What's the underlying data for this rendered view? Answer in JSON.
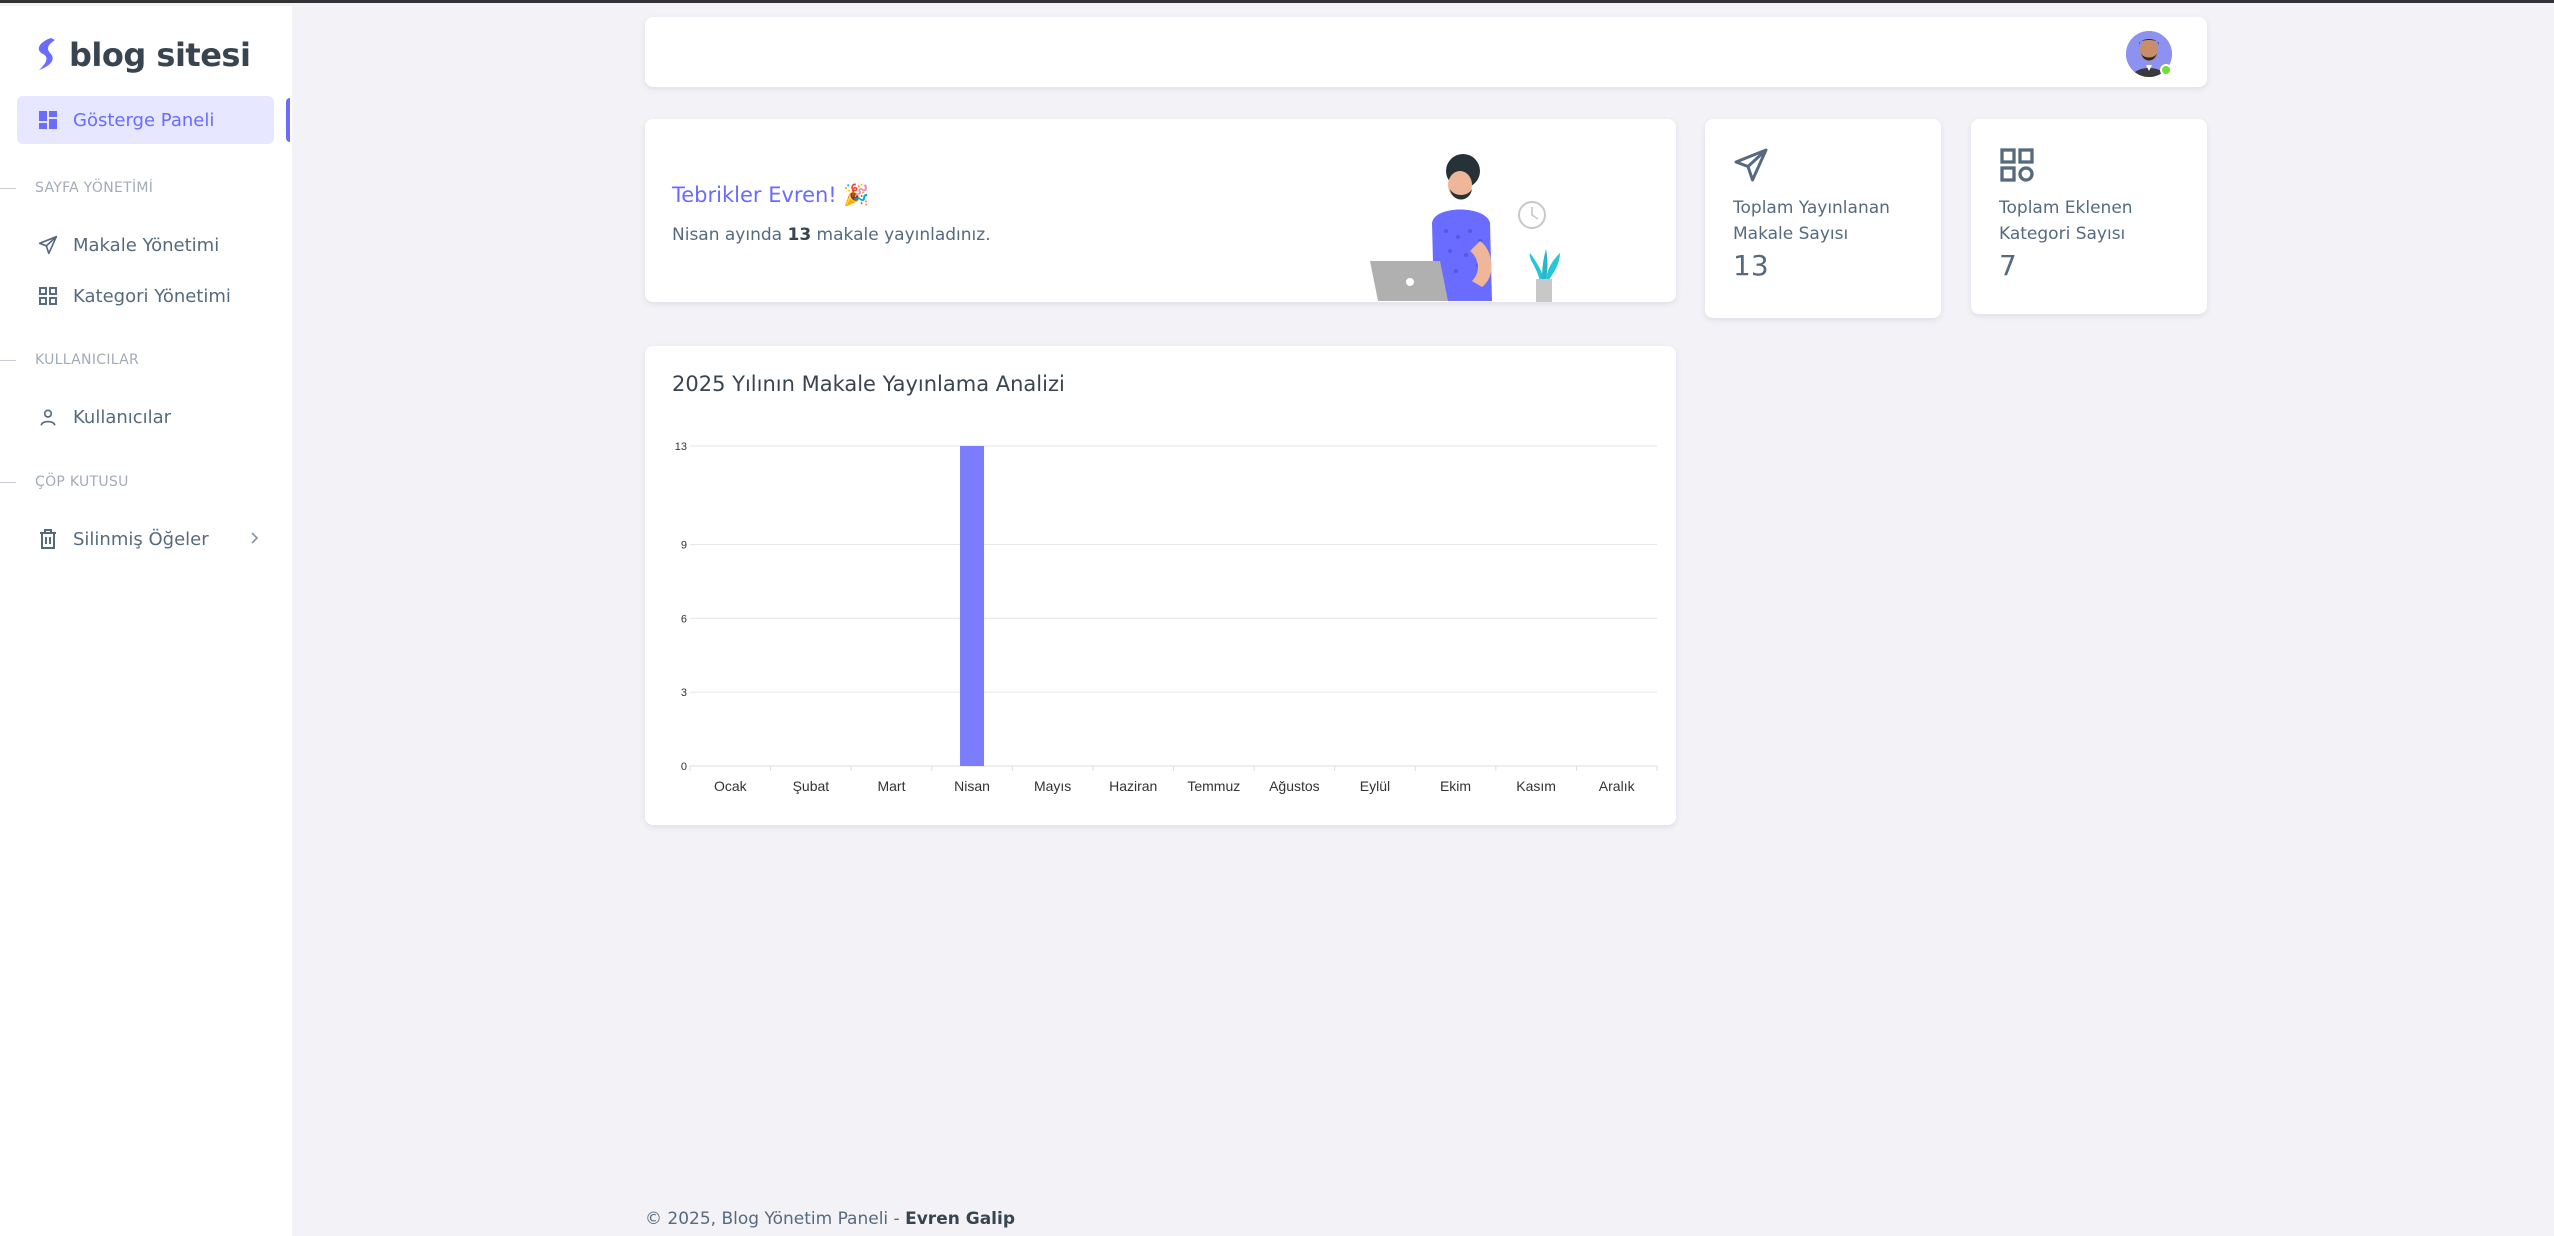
{
  "brand": {
    "name": "blog sitesi",
    "accent": "#696cff"
  },
  "sidebar": {
    "active_item": {
      "label": "Gösterge Paneli",
      "icon": "dashboard-icon"
    },
    "sections": [
      {
        "header": "SAYFA YÖNETİMİ",
        "items": [
          {
            "label": "Makale Yönetimi",
            "icon": "send-icon"
          },
          {
            "label": "Kategori Yönetimi",
            "icon": "grid-icon"
          }
        ]
      },
      {
        "header": "KULLANICILAR",
        "items": [
          {
            "label": "Kullanıcılar",
            "icon": "user-icon"
          }
        ]
      },
      {
        "header": "ÇÖP KUTUSU",
        "items": [
          {
            "label": "Silinmiş Öğeler",
            "icon": "trash-icon"
          }
        ]
      }
    ]
  },
  "navbar": {
    "avatar": "user-avatar",
    "status_color": "#71dd37"
  },
  "welcome": {
    "title": "Tebrikler Evren! 🎉",
    "text_before": "Nisan ayında ",
    "count": "13",
    "text_after": " makale yayınladınız."
  },
  "stats": [
    {
      "icon": "send-icon",
      "label": "Toplam Yayınlanan Makale Sayısı",
      "value": "13"
    },
    {
      "icon": "grid-icon",
      "label": "Toplam Eklenen Kategori Sayısı",
      "value": "7"
    }
  ],
  "chart_data": {
    "type": "bar",
    "title": "2025 Yılının Makale Yayınlama Analizi",
    "categories": [
      "Ocak",
      "Şubat",
      "Mart",
      "Nisan",
      "Mayıs",
      "Haziran",
      "Temmuz",
      "Ağustos",
      "Eylül",
      "Ekim",
      "Kasım",
      "Aralık"
    ],
    "values": [
      0,
      0,
      0,
      13,
      0,
      0,
      0,
      0,
      0,
      0,
      0,
      0
    ],
    "yticks": [
      0,
      3,
      6,
      9,
      13
    ],
    "ylim": [
      0,
      13
    ],
    "grid": true,
    "bar_color": "#7b7dfc"
  },
  "footer": {
    "text": "© 2025, Blog Yönetim Paneli - ",
    "author": "Evren Galip"
  }
}
